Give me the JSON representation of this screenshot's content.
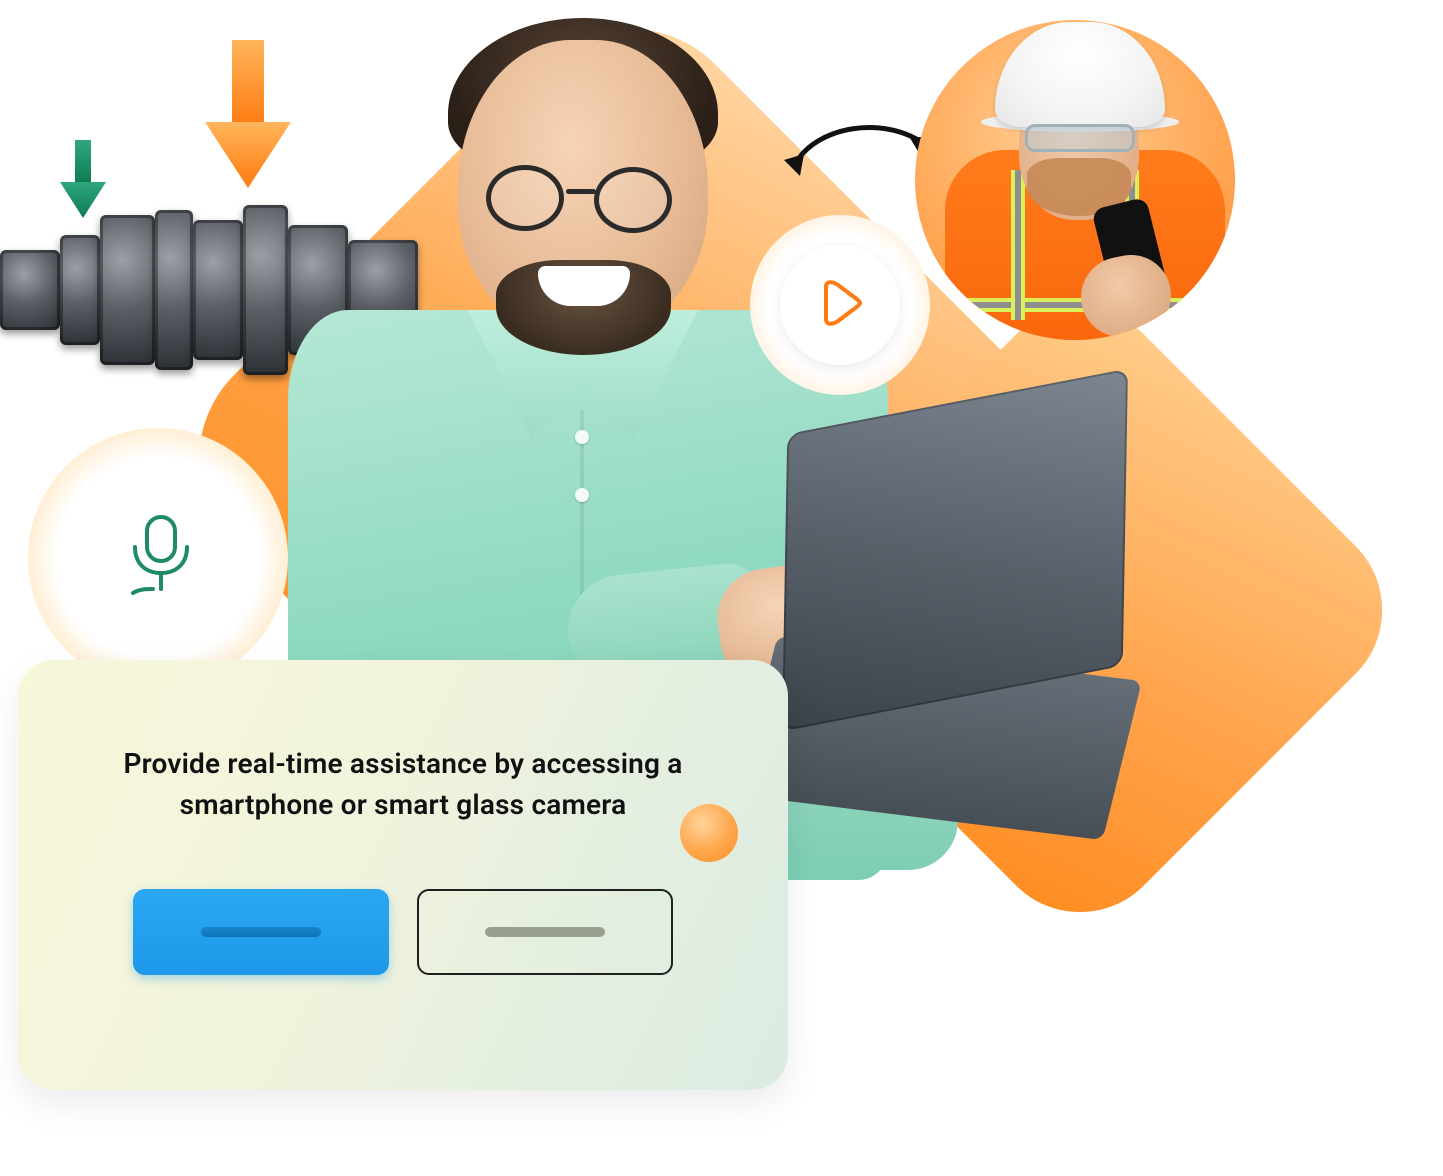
{
  "card": {
    "text": "Provide real-time assistance by accessing a smartphone or smart glass camera",
    "primary_label": "",
    "secondary_label": ""
  },
  "icons": {
    "play": "play-icon",
    "mic": "microphone-icon",
    "swap": "bidirectional-arrow-icon",
    "arrow_down_orange": "arrow-down-orange-icon",
    "arrow_down_green": "arrow-down-green-icon"
  },
  "colors": {
    "accent_orange": "#ff8c24",
    "accent_blue": "#1e98e8",
    "mint": "#8fd9c1",
    "card_bg_start": "#f7f7da",
    "card_bg_end": "#dcebe1"
  }
}
